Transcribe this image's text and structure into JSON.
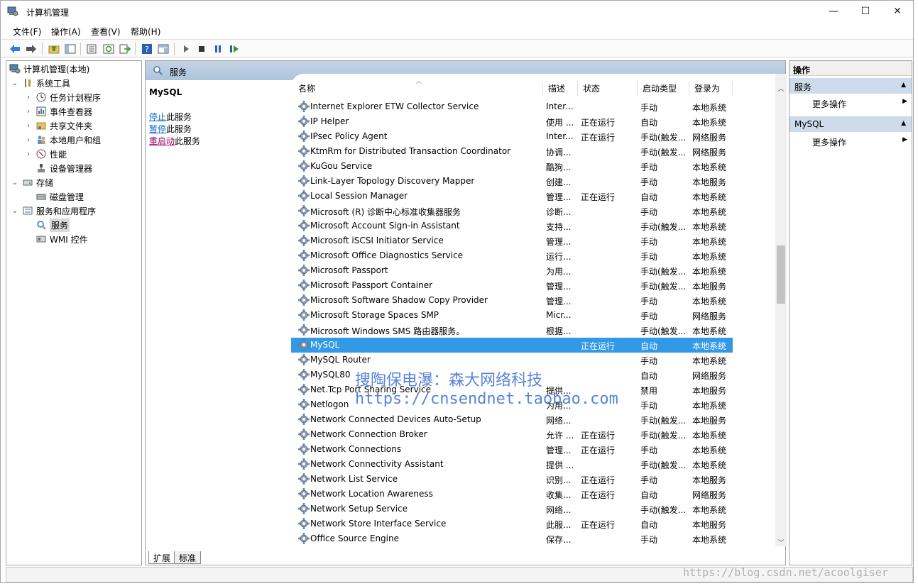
{
  "window": {
    "title": "计算机管理",
    "minimize": "—",
    "maximize": "☐",
    "close": "✕"
  },
  "menu": [
    "文件(F)",
    "操作(A)",
    "查看(V)",
    "帮助(H)"
  ],
  "toolbar_icons": [
    "back-icon",
    "forward-icon",
    "up-folder-icon",
    "show-tree-icon",
    "properties-icon",
    "refresh-icon",
    "export-icon",
    "help-icon",
    "console-icon",
    "play-icon",
    "stop-icon",
    "pause-icon",
    "restart-icon"
  ],
  "tree": {
    "root": "计算机管理(本地)",
    "system_tools": "系统工具",
    "task_scheduler": "任务计划程序",
    "event_viewer": "事件查看器",
    "shared_folders": "共享文件夹",
    "local_users": "本地用户和组",
    "performance": "性能",
    "device_manager": "设备管理器",
    "storage": "存储",
    "disk_management": "磁盘管理",
    "services_apps": "服务和应用程序",
    "services": "服务",
    "wmi": "WMI 控件"
  },
  "center": {
    "header": "服务",
    "selected_service": "MySQL",
    "actions": [
      {
        "link": "停止",
        "rest": "此服务"
      },
      {
        "link": "暂停",
        "rest": "此服务"
      },
      {
        "link": "重启动",
        "rest": "此服务"
      }
    ],
    "columns": {
      "name": "名称",
      "desc": "描述",
      "status": "状态",
      "startup": "启动类型",
      "logon": "登录为"
    },
    "rows": [
      {
        "name": "Internet Explorer ETW Collector Service",
        "desc": "Inter...",
        "status": "",
        "startup": "手动",
        "logon": "本地系统"
      },
      {
        "name": "IP Helper",
        "desc": "使用 ...",
        "status": "正在运行",
        "startup": "自动",
        "logon": "本地系统"
      },
      {
        "name": "IPsec Policy Agent",
        "desc": "Inter...",
        "status": "正在运行",
        "startup": "手动(触发...",
        "logon": "网络服务"
      },
      {
        "name": "KtmRm for Distributed Transaction Coordinator",
        "desc": "协调...",
        "status": "",
        "startup": "手动(触发...",
        "logon": "网络服务"
      },
      {
        "name": "KuGou Service",
        "desc": "酷狗...",
        "status": "",
        "startup": "手动",
        "logon": "本地系统"
      },
      {
        "name": "Link-Layer Topology Discovery Mapper",
        "desc": "创建...",
        "status": "",
        "startup": "手动",
        "logon": "本地服务"
      },
      {
        "name": "Local Session Manager",
        "desc": "管理...",
        "status": "正在运行",
        "startup": "自动",
        "logon": "本地系统"
      },
      {
        "name": "Microsoft (R) 诊断中心标准收集器服务",
        "desc": "诊断...",
        "status": "",
        "startup": "手动",
        "logon": "本地系统"
      },
      {
        "name": "Microsoft Account Sign-in Assistant",
        "desc": "支持...",
        "status": "",
        "startup": "手动(触发...",
        "logon": "本地系统"
      },
      {
        "name": "Microsoft iSCSI Initiator Service",
        "desc": "管理...",
        "status": "",
        "startup": "手动",
        "logon": "本地系统"
      },
      {
        "name": "Microsoft Office Diagnostics Service",
        "desc": "运行...",
        "status": "",
        "startup": "手动",
        "logon": "本地系统"
      },
      {
        "name": "Microsoft Passport",
        "desc": "为用...",
        "status": "",
        "startup": "手动(触发...",
        "logon": "本地系统"
      },
      {
        "name": "Microsoft Passport Container",
        "desc": "管理...",
        "status": "",
        "startup": "手动(触发...",
        "logon": "本地服务"
      },
      {
        "name": "Microsoft Software Shadow Copy Provider",
        "desc": "管理...",
        "status": "",
        "startup": "手动",
        "logon": "本地系统"
      },
      {
        "name": "Microsoft Storage Spaces SMP",
        "desc": "Micr...",
        "status": "",
        "startup": "手动",
        "logon": "网络服务"
      },
      {
        "name": "Microsoft Windows SMS 路由器服务。",
        "desc": "根据...",
        "status": "",
        "startup": "手动(触发...",
        "logon": "本地系统"
      },
      {
        "name": "MySQL",
        "desc": "",
        "status": "正在运行",
        "startup": "自动",
        "logon": "本地系统"
      },
      {
        "name": "MySQL Router",
        "desc": "",
        "status": "",
        "startup": "手动",
        "logon": "本地系统"
      },
      {
        "name": "MySQL80",
        "desc": "",
        "status": "",
        "startup": "自动",
        "logon": "网络服务"
      },
      {
        "name": "Net.Tcp Port Sharing Service",
        "desc": "提供...",
        "status": "",
        "startup": "禁用",
        "logon": "本地服务"
      },
      {
        "name": "Netlogon",
        "desc": "为用...",
        "status": "",
        "startup": "手动",
        "logon": "本地系统"
      },
      {
        "name": "Network Connected Devices Auto-Setup",
        "desc": "网络...",
        "status": "",
        "startup": "手动(触发...",
        "logon": "本地服务"
      },
      {
        "name": "Network Connection Broker",
        "desc": "允许 ...",
        "status": "正在运行",
        "startup": "手动(触发...",
        "logon": "本地系统"
      },
      {
        "name": "Network Connections",
        "desc": "管理...",
        "status": "正在运行",
        "startup": "手动",
        "logon": "本地系统"
      },
      {
        "name": "Network Connectivity Assistant",
        "desc": "提供 ...",
        "status": "",
        "startup": "手动(触发...",
        "logon": "本地系统"
      },
      {
        "name": "Network List Service",
        "desc": "识别...",
        "status": "正在运行",
        "startup": "手动",
        "logon": "本地服务"
      },
      {
        "name": "Network Location Awareness",
        "desc": "收集...",
        "status": "正在运行",
        "startup": "自动",
        "logon": "网络服务"
      },
      {
        "name": "Network Setup Service",
        "desc": "网络...",
        "status": "",
        "startup": "手动(触发...",
        "logon": "本地系统"
      },
      {
        "name": "Network Store Interface Service",
        "desc": "此服...",
        "status": "正在运行",
        "startup": "自动",
        "logon": "本地服务"
      },
      {
        "name": "Office  Source Engine",
        "desc": "保存...",
        "status": "",
        "startup": "手动",
        "logon": "本地系统"
      }
    ],
    "selected_index": 16,
    "tabs": [
      "扩展",
      "标准"
    ]
  },
  "actions_pane": {
    "header": "操作",
    "sections": [
      {
        "title": "服务",
        "item": "更多操作"
      },
      {
        "title": "MySQL",
        "item": "更多操作"
      }
    ]
  },
  "watermarks": {
    "line1": "搜陶保电瀑：森大网络科技",
    "line2": "https://cnsendnet.taobao.com",
    "corner": "https://blog.csdn.net/acoolgiser"
  },
  "colors": {
    "selection": "#3399e6",
    "header_gradient": "#b8cce2",
    "section": "#cddbea",
    "link": "#0066cc"
  }
}
